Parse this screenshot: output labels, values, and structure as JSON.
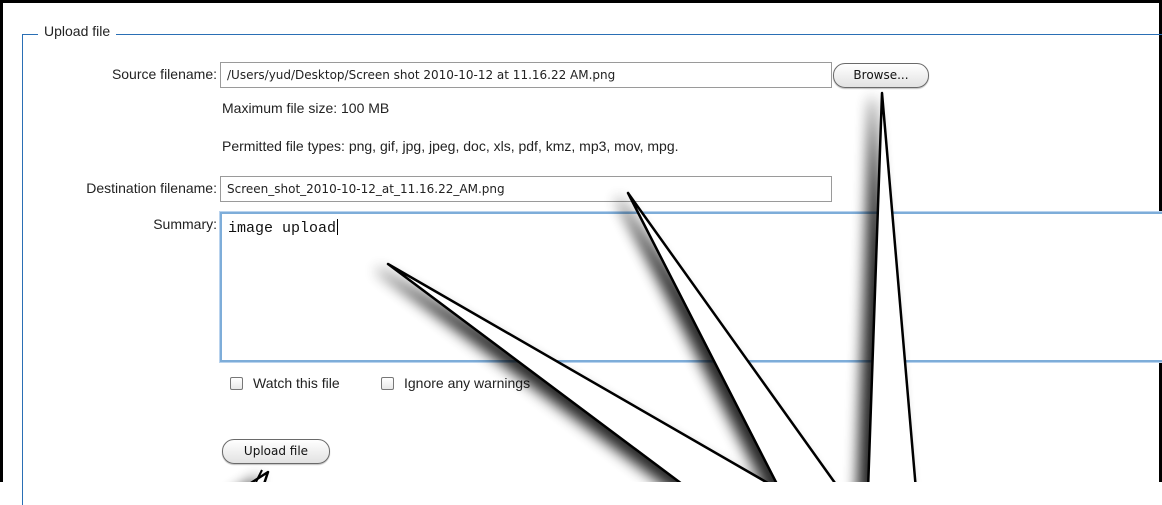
{
  "form": {
    "legend": "Upload file",
    "source": {
      "label": "Source filename:",
      "value": "/Users/yud/Desktop/Screen shot 2010-10-12 at 11.16.22 AM.png",
      "browse_label": "Browse..."
    },
    "max_size_text": "Maximum file size: 100 MB",
    "permitted_types_text": "Permitted file types: png, gif, jpg, jpeg, doc, xls, pdf, kmz, mp3, mov, mpg.",
    "destination": {
      "label": "Destination filename:",
      "value": "Screen_shot_2010-10-12_at_11.16.22_AM.png"
    },
    "summary": {
      "label": "Summary:",
      "value": "image upload"
    },
    "watch_label": "Watch this file",
    "ignore_label": "Ignore any warnings",
    "upload_button_label": "Upload file"
  },
  "colors": {
    "fieldset_border": "#2a6fb5",
    "focus_border": "#7eadd9",
    "callout_fill": "#ffffff",
    "callout_stroke": "#000000"
  }
}
